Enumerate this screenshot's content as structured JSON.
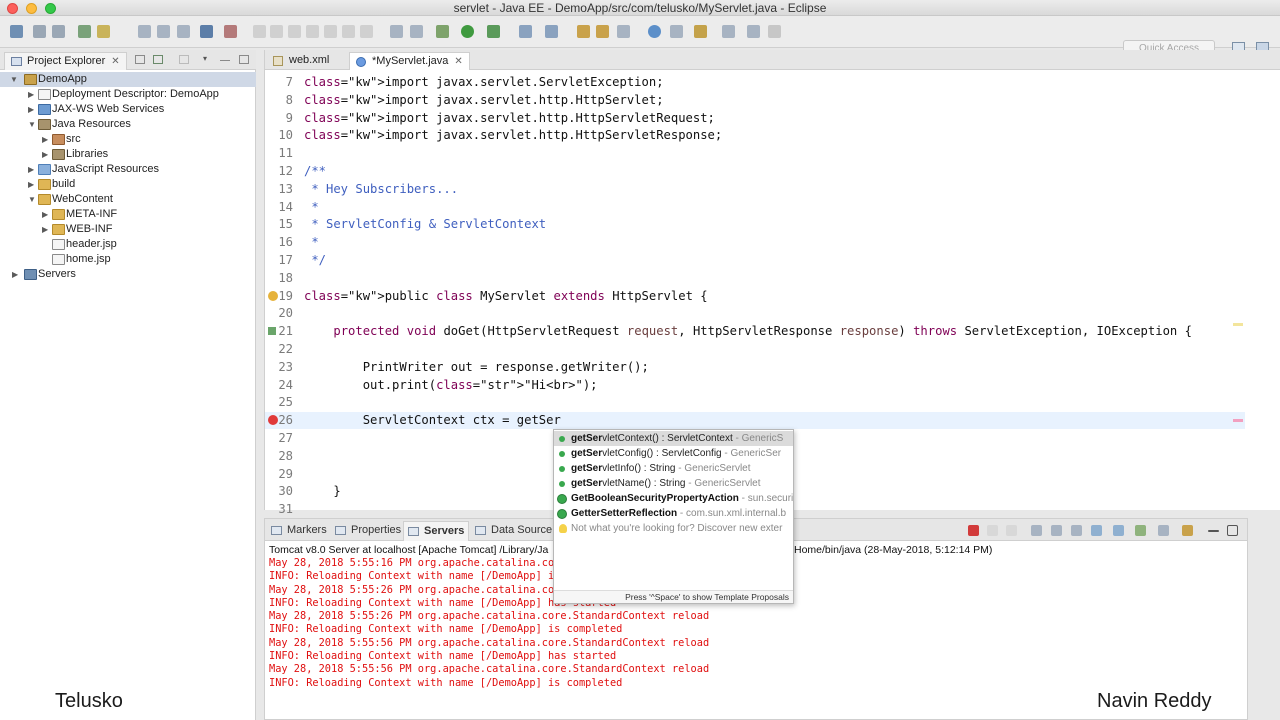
{
  "window": {
    "title": "servlet - Java EE - DemoApp/src/com/telusko/MyServlet.java - Eclipse"
  },
  "toolbar": {
    "quick_access_placeholder": "Quick Access"
  },
  "project_explorer": {
    "tab_label": "Project Explorer",
    "close_glyph": "✕",
    "items": [
      {
        "label": "DemoApp",
        "icon": "project-icon",
        "expanded": true
      },
      {
        "label": "Deployment Descriptor: DemoApp",
        "icon": "descriptor-icon"
      },
      {
        "label": "JAX-WS Web Services",
        "icon": "webservices-icon"
      },
      {
        "label": "Java Resources",
        "icon": "java-resources-icon",
        "expanded": true
      },
      {
        "label": "src",
        "icon": "package-icon"
      },
      {
        "label": "Libraries",
        "icon": "library-icon"
      },
      {
        "label": "JavaScript Resources",
        "icon": "javascript-icon"
      },
      {
        "label": "build",
        "icon": "folder-icon"
      },
      {
        "label": "WebContent",
        "icon": "folder-icon",
        "expanded": true
      },
      {
        "label": "META-INF",
        "icon": "folder-icon"
      },
      {
        "label": "WEB-INF",
        "icon": "folder-icon"
      },
      {
        "label": "header.jsp",
        "icon": "file-icon"
      },
      {
        "label": "home.jsp",
        "icon": "file-icon"
      },
      {
        "label": "Servers",
        "icon": "servers-icon"
      }
    ]
  },
  "editor": {
    "tabs": [
      {
        "label": "web.xml",
        "active": false
      },
      {
        "label": "*MyServlet.java",
        "active": true
      }
    ],
    "lines": [
      {
        "n": "7",
        "text": "import javax.servlet.ServletException;"
      },
      {
        "n": "8",
        "text": "import javax.servlet.http.HttpServlet;"
      },
      {
        "n": "9",
        "text": "import javax.servlet.http.HttpServletRequest;"
      },
      {
        "n": "10",
        "text": "import javax.servlet.http.HttpServletResponse;"
      },
      {
        "n": "11",
        "text": ""
      },
      {
        "n": "12",
        "text": "/**"
      },
      {
        "n": "13",
        "text": " * Hey Subscribers..."
      },
      {
        "n": "14",
        "text": " *"
      },
      {
        "n": "15",
        "text": " * ServletConfig & ServletContext"
      },
      {
        "n": "16",
        "text": " *"
      },
      {
        "n": "17",
        "text": " */"
      },
      {
        "n": "18",
        "text": ""
      },
      {
        "n": "19",
        "text": "public class MyServlet extends HttpServlet {"
      },
      {
        "n": "20",
        "text": ""
      },
      {
        "n": "21",
        "text": "    protected void doGet(HttpServletRequest request, HttpServletResponse response) throws ServletException, IOException {"
      },
      {
        "n": "22",
        "text": ""
      },
      {
        "n": "23",
        "text": "        PrintWriter out = response.getWriter();"
      },
      {
        "n": "24",
        "text": "        out.print(\"Hi<br>\");"
      },
      {
        "n": "25",
        "text": ""
      },
      {
        "n": "26",
        "text": "        ServletContext ctx = getSer"
      },
      {
        "n": "27",
        "text": ""
      },
      {
        "n": "28",
        "text": ""
      },
      {
        "n": "29",
        "text": ""
      },
      {
        "n": "30",
        "text": "    }"
      },
      {
        "n": "31",
        "text": ""
      }
    ]
  },
  "content_assist": {
    "items": [
      {
        "bold": "getSer",
        "rest": "vletContext() : ServletContext",
        "owner": " - GenericS"
      },
      {
        "bold": "getSer",
        "rest": "vletConfig() : ServletConfig",
        "owner": " - GenericSer"
      },
      {
        "bold": "getSer",
        "rest": "vletInfo() : String",
        "owner": " - GenericServlet"
      },
      {
        "bold": "getSer",
        "rest": "vletName() : String",
        "owner": " - GenericServlet"
      },
      {
        "bold": "GetBooleanSecurityPropertyAction",
        "rest": "",
        "owner": " - sun.securi"
      },
      {
        "bold": "GetterSetterReflection",
        "rest": "",
        "owner": " - com.sun.xml.internal.b"
      }
    ],
    "hint": "Not what you're looking for? Discover new exter",
    "footer": "Press '^Space' to show Template Proposals"
  },
  "console": {
    "tabs": [
      "Markers",
      "Properties",
      "Servers",
      "Data Source"
    ],
    "active_tab": "Servers",
    "header_left": "Tomcat v8.0 Server at localhost [Apache Tomcat] /Library/Ja",
    "header_right": "Home/bin/java (28-May-2018, 5:12:14 PM)",
    "lines": [
      "May 28, 2018 5:55:16 PM org.apache.catalina.co",
      "INFO: Reloading Context with name [/DemoApp] i",
      "May 28, 2018 5:55:26 PM org.apache.catalina.co",
      "INFO: Reloading Context with name [/DemoApp] has started",
      "May 28, 2018 5:55:26 PM org.apache.catalina.core.StandardContext reload",
      "INFO: Reloading Context with name [/DemoApp] is completed",
      "May 28, 2018 5:55:56 PM org.apache.catalina.core.StandardContext reload",
      "INFO: Reloading Context with name [/DemoApp] has started",
      "May 28, 2018 5:55:56 PM org.apache.catalina.core.StandardContext reload",
      "INFO: Reloading Context with name [/DemoApp] is completed"
    ]
  },
  "watermarks": {
    "left": "Telusko",
    "right": "Navin Reddy"
  },
  "colors": {
    "keyword": "#7f0055",
    "comment": "#3f5fbf",
    "string": "#2a00ff",
    "console_text": "#e01010",
    "current_line": "#e8f2fe"
  }
}
